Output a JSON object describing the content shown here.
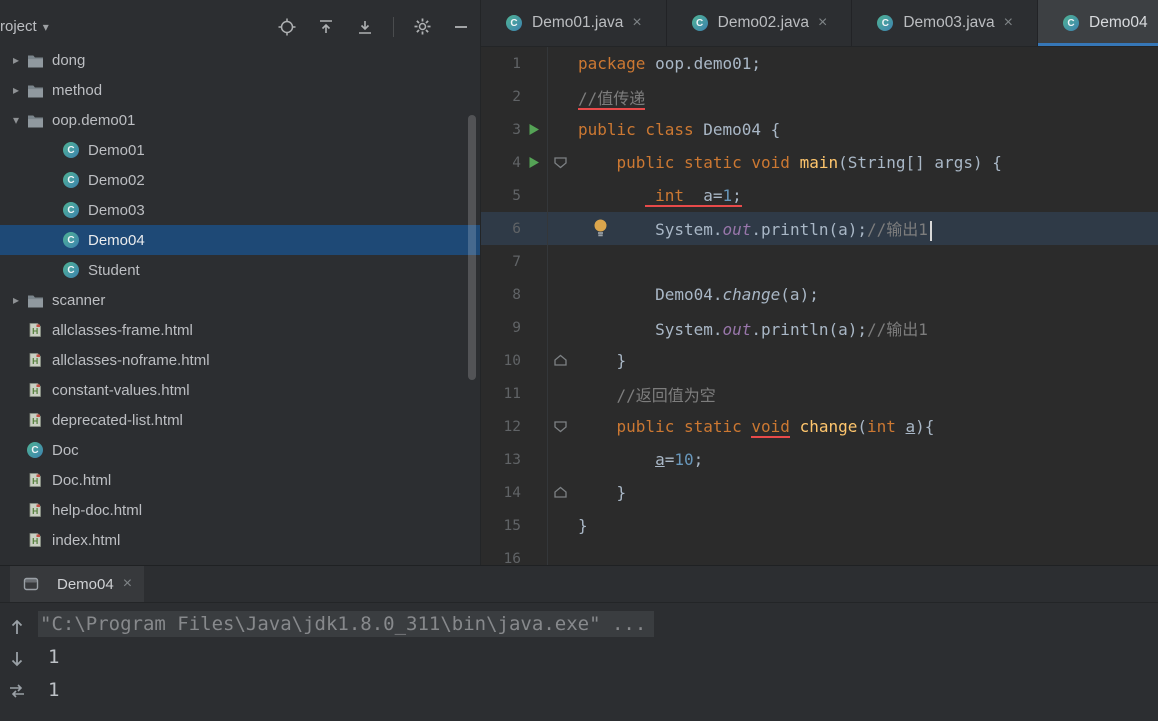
{
  "colors": {
    "accent": "#3677b8",
    "selection": "#1e4976",
    "err": "#e84a4a",
    "kw": "#cc7832",
    "num": "#6897bb",
    "fn": "#ffc66d",
    "field": "#9876aa",
    "cm": "#7d7d7d",
    "pl": "#a9b7c6",
    "run_green": "#55a356"
  },
  "project_panel": {
    "title": "roject",
    "toolbar_icons": [
      "locate-icon",
      "collapse-all-icon",
      "expand-all-icon",
      "separator",
      "gear-icon",
      "minimize-icon"
    ],
    "tree": [
      {
        "label": "dong",
        "kind": "folder",
        "chevron": "collapsed",
        "level": 0
      },
      {
        "label": "method",
        "kind": "folder",
        "chevron": "collapsed",
        "level": 0
      },
      {
        "label": "oop.demo01",
        "kind": "folder",
        "chevron": "expanded",
        "level": 0
      },
      {
        "label": "Demo01",
        "kind": "class",
        "level": 1
      },
      {
        "label": "Demo02",
        "kind": "class",
        "level": 1
      },
      {
        "label": "Demo03",
        "kind": "class",
        "level": 1
      },
      {
        "label": "Demo04",
        "kind": "class",
        "level": 1,
        "selected": true
      },
      {
        "label": "Student",
        "kind": "class",
        "level": 1
      },
      {
        "label": "scanner",
        "kind": "folder",
        "chevron": "collapsed",
        "level": 0
      },
      {
        "label": "allclasses-frame.html",
        "kind": "html",
        "level": 0
      },
      {
        "label": "allclasses-noframe.html",
        "kind": "html",
        "level": 0
      },
      {
        "label": "constant-values.html",
        "kind": "html",
        "level": 0
      },
      {
        "label": "deprecated-list.html",
        "kind": "html",
        "level": 0
      },
      {
        "label": "Doc",
        "kind": "class",
        "level": 0
      },
      {
        "label": "Doc.html",
        "kind": "html",
        "level": 0
      },
      {
        "label": "help-doc.html",
        "kind": "html",
        "level": 0
      },
      {
        "label": "index.html",
        "kind": "html",
        "level": 0
      },
      {
        "label": "",
        "kind": "partial",
        "level": 0
      }
    ]
  },
  "editor": {
    "tabs": [
      {
        "label": "Demo01.java",
        "active": false
      },
      {
        "label": "Demo02.java",
        "active": false
      },
      {
        "label": "Demo03.java",
        "active": false
      },
      {
        "label": "Demo04",
        "active": true
      }
    ],
    "lines": [
      {
        "num": 1,
        "segments": [
          {
            "t": "package ",
            "c": "kw"
          },
          {
            "t": "oop.demo01;",
            "c": "pl"
          }
        ]
      },
      {
        "num": 2,
        "segments": [
          {
            "t": "//值传递",
            "c": "cm err"
          }
        ]
      },
      {
        "num": 3,
        "run": true,
        "segments": [
          {
            "t": "public class ",
            "c": "kw"
          },
          {
            "t": "Demo04 {",
            "c": "pl"
          }
        ]
      },
      {
        "num": 4,
        "run": true,
        "fold": "start",
        "segments": [
          {
            "t": "    ",
            "c": "pl"
          },
          {
            "t": "public static void ",
            "c": "kw"
          },
          {
            "t": "main",
            "c": "fn"
          },
          {
            "t": "(String[] args) {",
            "c": "pl"
          }
        ]
      },
      {
        "num": 5,
        "segments": [
          {
            "t": "       ",
            "c": "pl"
          },
          {
            "t": " ",
            "c": "pl err"
          },
          {
            "t": "int",
            "c": "kw err"
          },
          {
            "t": "  ",
            "c": "pl err"
          },
          {
            "t": "a",
            "c": "pl err"
          },
          {
            "t": "=",
            "c": "pl err"
          },
          {
            "t": "1",
            "c": "num err"
          },
          {
            "t": ";",
            "c": "pl err"
          }
        ]
      },
      {
        "num": 6,
        "current": true,
        "bulb": true,
        "caret": true,
        "segments": [
          {
            "t": "        ",
            "c": "pl"
          },
          {
            "t": "System.",
            "c": "pl"
          },
          {
            "t": "out",
            "c": "field"
          },
          {
            "t": ".println(a);",
            "c": "pl"
          },
          {
            "t": "//输出1",
            "c": "cm"
          }
        ]
      },
      {
        "num": 7,
        "segments": []
      },
      {
        "num": 8,
        "segments": [
          {
            "t": "        ",
            "c": "pl"
          },
          {
            "t": "Demo04.",
            "c": "pl"
          },
          {
            "t": "change",
            "c": "it"
          },
          {
            "t": "(a);",
            "c": "pl"
          }
        ]
      },
      {
        "num": 9,
        "segments": [
          {
            "t": "        ",
            "c": "pl"
          },
          {
            "t": "System.",
            "c": "pl"
          },
          {
            "t": "out",
            "c": "field"
          },
          {
            "t": ".println(a);",
            "c": "pl"
          },
          {
            "t": "//输出1",
            "c": "cm"
          }
        ]
      },
      {
        "num": 10,
        "fold": "end",
        "segments": [
          {
            "t": "    }",
            "c": "pl"
          }
        ]
      },
      {
        "num": 11,
        "segments": [
          {
            "t": "    ",
            "c": "pl"
          },
          {
            "t": "//返回值为空",
            "c": "cm"
          }
        ]
      },
      {
        "num": 12,
        "fold": "start",
        "segments": [
          {
            "t": "    ",
            "c": "pl"
          },
          {
            "t": "public static ",
            "c": "kw"
          },
          {
            "t": "void",
            "c": "kw err"
          },
          {
            "t": " ",
            "c": "pl"
          },
          {
            "t": "change",
            "c": "fn"
          },
          {
            "t": "(",
            "c": "pl"
          },
          {
            "t": "int ",
            "c": "kw"
          },
          {
            "t": "a",
            "c": "pl u"
          },
          {
            "t": "){",
            "c": "pl"
          }
        ]
      },
      {
        "num": 13,
        "segments": [
          {
            "t": "        ",
            "c": "pl"
          },
          {
            "t": "a",
            "c": "pl u"
          },
          {
            "t": "=",
            "c": "pl"
          },
          {
            "t": "10",
            "c": "num"
          },
          {
            "t": ";",
            "c": "pl"
          }
        ]
      },
      {
        "num": 14,
        "fold": "end",
        "segments": [
          {
            "t": "    }",
            "c": "pl"
          }
        ]
      },
      {
        "num": 15,
        "segments": [
          {
            "t": "}",
            "c": "pl"
          }
        ]
      },
      {
        "num": 16,
        "segments": []
      }
    ]
  },
  "run_panel": {
    "tab_label": "Demo04",
    "toolbar_icons": [
      "arrow-up-icon",
      "arrow-down-icon",
      "soft-wrap-icon"
    ],
    "console_lines": [
      {
        "text": "\"C:\\Program Files\\Java\\jdk1.8.0_311\\bin\\java.exe\" ...",
        "style": "cmd"
      },
      {
        "text": "1",
        "style": "out"
      },
      {
        "text": "1",
        "style": "out"
      }
    ]
  }
}
